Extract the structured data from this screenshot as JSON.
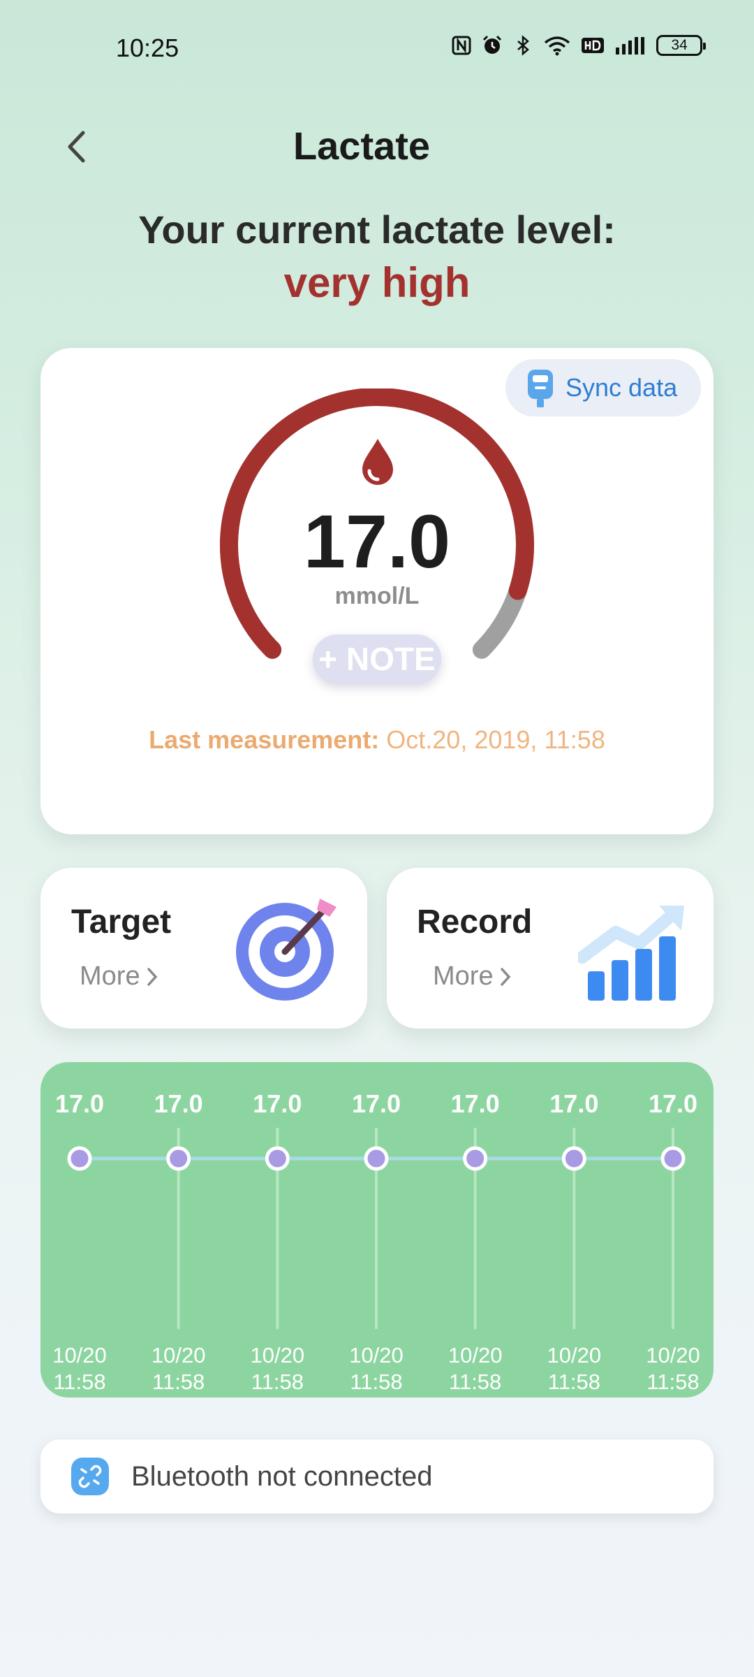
{
  "status_bar": {
    "time": "10:25",
    "battery": "34"
  },
  "header": {
    "title": "Lactate"
  },
  "status": {
    "headline": "Your current lactate level:",
    "level": "very high",
    "level_color": "#a3322f"
  },
  "reading": {
    "value": "17.0",
    "unit": "mmol/L",
    "note_label": "+ NOTE",
    "sync_label": "Sync data",
    "last_label": "Last measurement:",
    "last_value": "Oct.20, 2019, 11:58",
    "gauge_level": 0.9
  },
  "cards": {
    "target": {
      "title": "Target",
      "more": "More"
    },
    "record": {
      "title": "Record",
      "more": "More"
    }
  },
  "chart_data": {
    "type": "line",
    "points": [
      {
        "value": "17.0",
        "date": "10/20",
        "time": "11:58"
      },
      {
        "value": "17.0",
        "date": "10/20",
        "time": "11:58"
      },
      {
        "value": "17.0",
        "date": "10/20",
        "time": "11:58"
      },
      {
        "value": "17.0",
        "date": "10/20",
        "time": "11:58"
      },
      {
        "value": "17.0",
        "date": "10/20",
        "time": "11:58"
      },
      {
        "value": "17.0",
        "date": "10/20",
        "time": "11:58"
      },
      {
        "value": "17.0",
        "date": "10/20",
        "time": "11:58"
      }
    ]
  },
  "bluetooth": {
    "text": "Bluetooth not connected"
  },
  "colors": {
    "accent": "#a3322f",
    "chart_bg": "#8dd5a0",
    "point": "#a99be3",
    "line": "#a8dbe4"
  }
}
